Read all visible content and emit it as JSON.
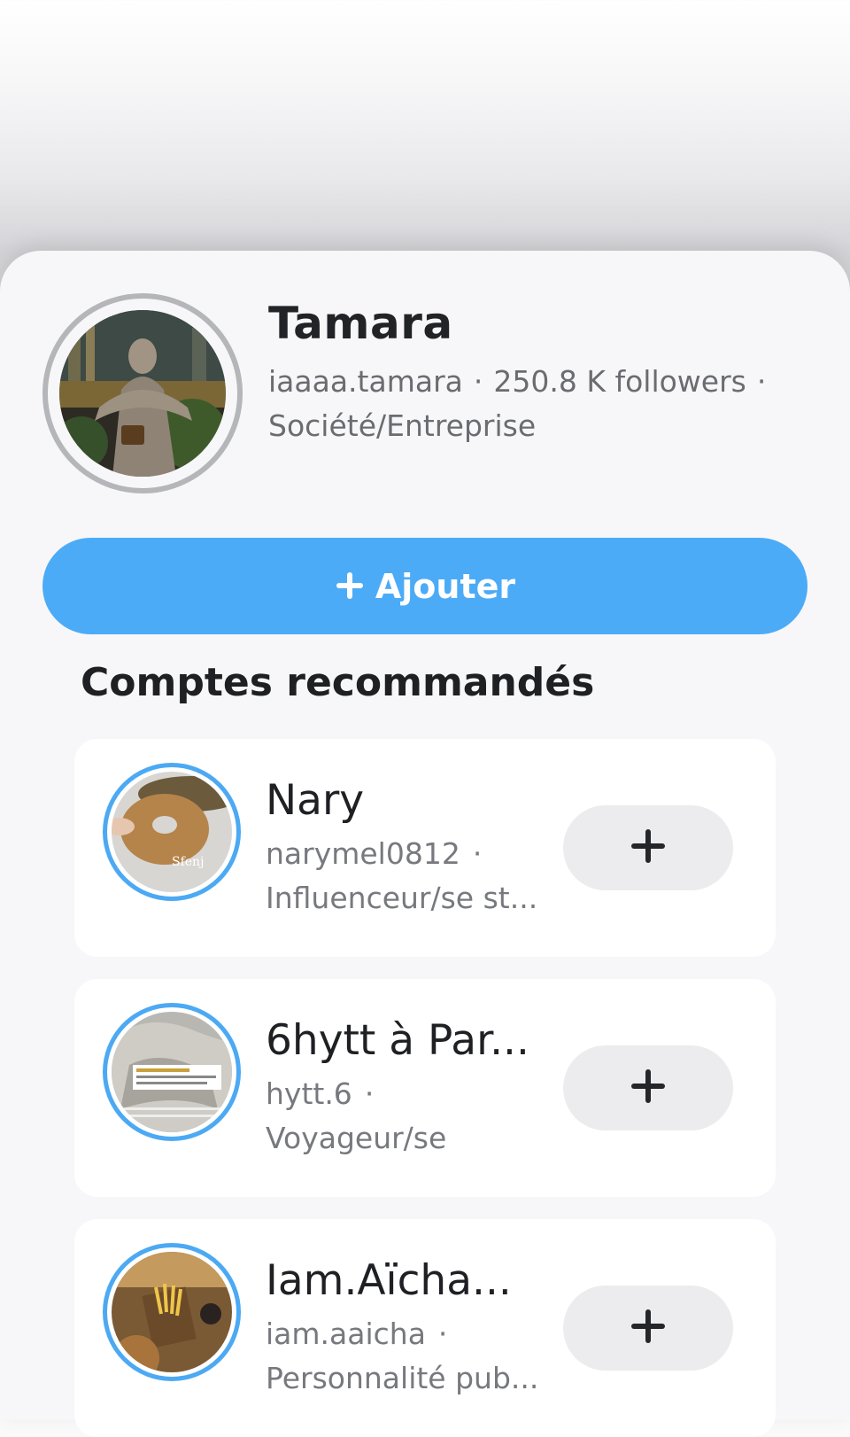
{
  "profile": {
    "name": "Tamara",
    "username": "iaaaa.tamara",
    "followers": "250.8 K followers",
    "category": "Société/Entreprise"
  },
  "add_button": {
    "icon": "plus-icon",
    "label": "Ajouter"
  },
  "section": {
    "title": "Comptes recommandés"
  },
  "recommended": [
    {
      "name": "Nary",
      "username": "narymel0812",
      "category": "Influenceur/se st...",
      "avatar_caption": "Sfenj",
      "button_icon": "plus-icon"
    },
    {
      "name": "6hytt à Par...",
      "username": "hytt.6",
      "category": "Voyageur/se",
      "button_icon": "plus-icon"
    },
    {
      "name": "Iam.Aïcha...",
      "username": "iam.aaicha",
      "category": "Personnalité pub...",
      "button_icon": "plus-icon"
    }
  ],
  "colors": {
    "accent": "#4cabf7",
    "ring": "#4ca9f3",
    "avatar_ring": "#b5b6b9"
  }
}
